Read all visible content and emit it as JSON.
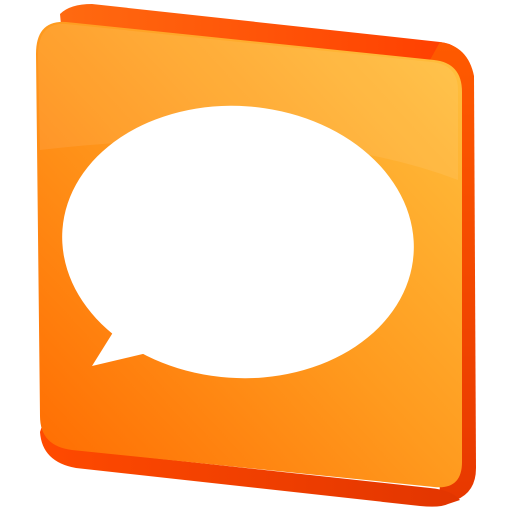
{
  "icon": {
    "name": "chat-bubble-icon",
    "colors": {
      "face_light": "#FFC240",
      "face_mid": "#FF9A1E",
      "face_dark": "#FF6A00",
      "side_light": "#FF5A00",
      "side_dark": "#E83800",
      "bubble": "#FFFFFF"
    }
  }
}
